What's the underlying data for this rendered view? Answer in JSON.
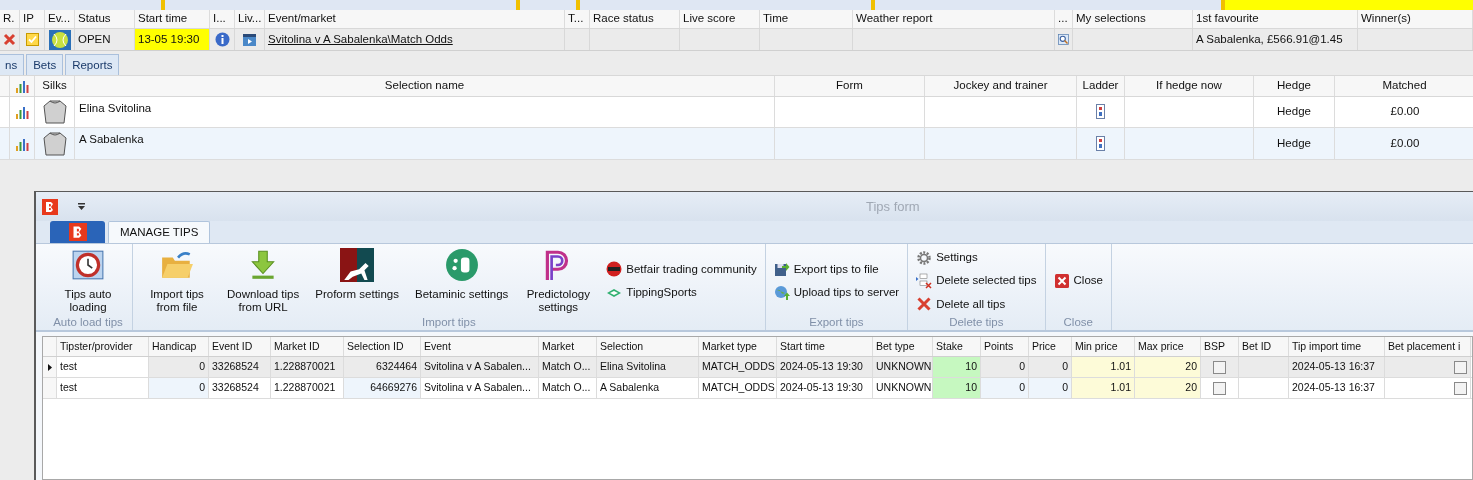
{
  "markets_grid": {
    "columns": [
      "R.",
      "IP",
      "Ev...",
      "Status",
      "Start time",
      "I...",
      "Liv...",
      "Event/market",
      "T...",
      "Race status",
      "Live score",
      "Time",
      "Weather report",
      "...",
      "My selections",
      "1st favourite",
      "Winner(s)"
    ],
    "rows": [
      {
        "in_play": true,
        "status": "OPEN",
        "start_time": "13-05 19:30",
        "event_market": "Svitolina v A Sabalenka\\Match Odds",
        "first_favourite": "A Sabalenka, £566.91@1.45"
      }
    ]
  },
  "detail_tabs": [
    {
      "label": "ns",
      "selected": false
    },
    {
      "label": "Bets",
      "selected": false
    },
    {
      "label": "Reports",
      "selected": false
    }
  ],
  "selections_grid": {
    "columns": [
      "Silks",
      "Selection name",
      "Form",
      "Jockey and trainer",
      "Ladder",
      "If hedge now",
      "Hedge",
      "Matched"
    ],
    "rows": [
      {
        "name": "Elina Svitolina",
        "hedge": "Hedge",
        "matched": "£0.00"
      },
      {
        "name": "A Sabalenka",
        "hedge": "Hedge",
        "matched": "£0.00"
      }
    ]
  },
  "tips_form": {
    "title": "Tips form",
    "ribbon_tabs": [
      {
        "label": "MANAGE TIPS",
        "selected": true
      }
    ],
    "groups": [
      {
        "label": "Auto load tips",
        "items": [
          {
            "kind": "large",
            "label": "Tips auto\nloading"
          }
        ]
      },
      {
        "label": "Import tips",
        "items": [
          {
            "kind": "large",
            "label": "Import tips\nfrom file"
          },
          {
            "kind": "large",
            "label": "Download tips\nfrom URL"
          },
          {
            "kind": "large",
            "label": "Proform settings"
          },
          {
            "kind": "large",
            "label": "Betaminic settings"
          },
          {
            "kind": "large",
            "label": "Predictology\nsettings"
          },
          {
            "kind": "small",
            "label": "Betfair trading community"
          },
          {
            "kind": "small",
            "label": "TippingSports"
          }
        ]
      },
      {
        "label": "Export tips",
        "items": [
          {
            "kind": "small",
            "label": "Export tips to file"
          },
          {
            "kind": "small",
            "label": "Upload tips to server"
          }
        ]
      },
      {
        "label": "Delete tips",
        "items": [
          {
            "kind": "small",
            "label": "Settings"
          },
          {
            "kind": "small",
            "label": "Delete selected tips"
          },
          {
            "kind": "small",
            "label": "Delete all tips"
          }
        ]
      },
      {
        "label": "Close",
        "items": [
          {
            "kind": "small",
            "label": "Close"
          }
        ]
      }
    ],
    "grid": {
      "columns": [
        "Tipster/provider",
        "Handicap",
        "Event ID",
        "Market ID",
        "Selection ID",
        "Event",
        "Market",
        "Selection",
        "Market type",
        "Start time",
        "Bet type",
        "Stake",
        "Points",
        "Price",
        "Min price",
        "Max price",
        "BSP",
        "Bet ID",
        "Tip import time",
        "Bet placement i"
      ],
      "rows": [
        {
          "selected": true,
          "cells": [
            "test",
            "0",
            "33268524",
            "1.228870021",
            "6324464",
            "Svitolina v A Sabalen...",
            "Match O...",
            "Elina Svitolina",
            "MATCH_ODDS",
            "2024-05-13 19:30",
            "UNKNOWN",
            "10",
            "0",
            "0",
            "1.01",
            "20"
          ],
          "bsp": false,
          "import_time": "2024-05-13 16:37",
          "bet_placement": false
        },
        {
          "selected": false,
          "cells": [
            "test",
            "0",
            "33268524",
            "1.228870021",
            "64669276",
            "Svitolina v A Sabalen...",
            "Match O...",
            "A Sabalenka",
            "MATCH_ODDS",
            "2024-05-13 19:30",
            "UNKNOWN",
            "10",
            "0",
            "0",
            "1.01",
            "20"
          ],
          "bsp": false,
          "import_time": "2024-05-13 16:37",
          "bet_placement": false
        }
      ]
    }
  }
}
